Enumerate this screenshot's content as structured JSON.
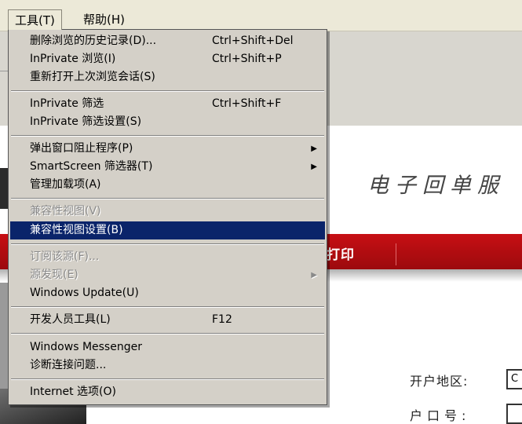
{
  "menubar": {
    "tools": "工具(T)",
    "help": "帮助(H)"
  },
  "background": {
    "red_tab": "打印",
    "site_title": "电子回单服",
    "field1_label": "开户地区:",
    "field2_label": "户口号:",
    "field1_value": "C"
  },
  "tools_menu": {
    "items": [
      {
        "label": "删除浏览的历史记录(D)...",
        "shortcut": "Ctrl+Shift+Del"
      },
      {
        "label": "InPrivate 浏览(I)",
        "shortcut": "Ctrl+Shift+P"
      },
      {
        "label": "重新打开上次浏览会话(S)",
        "shortcut": ""
      },
      {
        "label": "InPrivate 筛选",
        "shortcut": "Ctrl+Shift+F"
      },
      {
        "label": "InPrivate 筛选设置(S)",
        "shortcut": ""
      },
      {
        "label": "弹出窗口阻止程序(P)",
        "shortcut": "",
        "submenu_icon": "arrow-right-icon"
      },
      {
        "label": "SmartScreen 筛选器(T)",
        "shortcut": "",
        "submenu_icon": "arrow-right-icon"
      },
      {
        "label": "管理加载项(A)",
        "shortcut": ""
      },
      {
        "label": "兼容性视图(V)",
        "shortcut": "",
        "disabled": true
      },
      {
        "label": "兼容性视图设置(B)",
        "shortcut": "",
        "highlighted": true
      },
      {
        "label": "订阅该源(F)...",
        "shortcut": "",
        "disabled": true
      },
      {
        "label": "源发现(E)",
        "shortcut": "",
        "disabled": true,
        "submenu_icon": "arrow-right-icon"
      },
      {
        "label": "Windows Update(U)",
        "shortcut": ""
      },
      {
        "label": "开发人员工具(L)",
        "shortcut": "F12"
      },
      {
        "label": "Windows Messenger",
        "shortcut": ""
      },
      {
        "label": "诊断连接问题...",
        "shortcut": ""
      },
      {
        "label": "Internet 选项(O)",
        "shortcut": ""
      }
    ],
    "highlight_color": "#0a246a",
    "menu_background": "#d4d0c8"
  }
}
